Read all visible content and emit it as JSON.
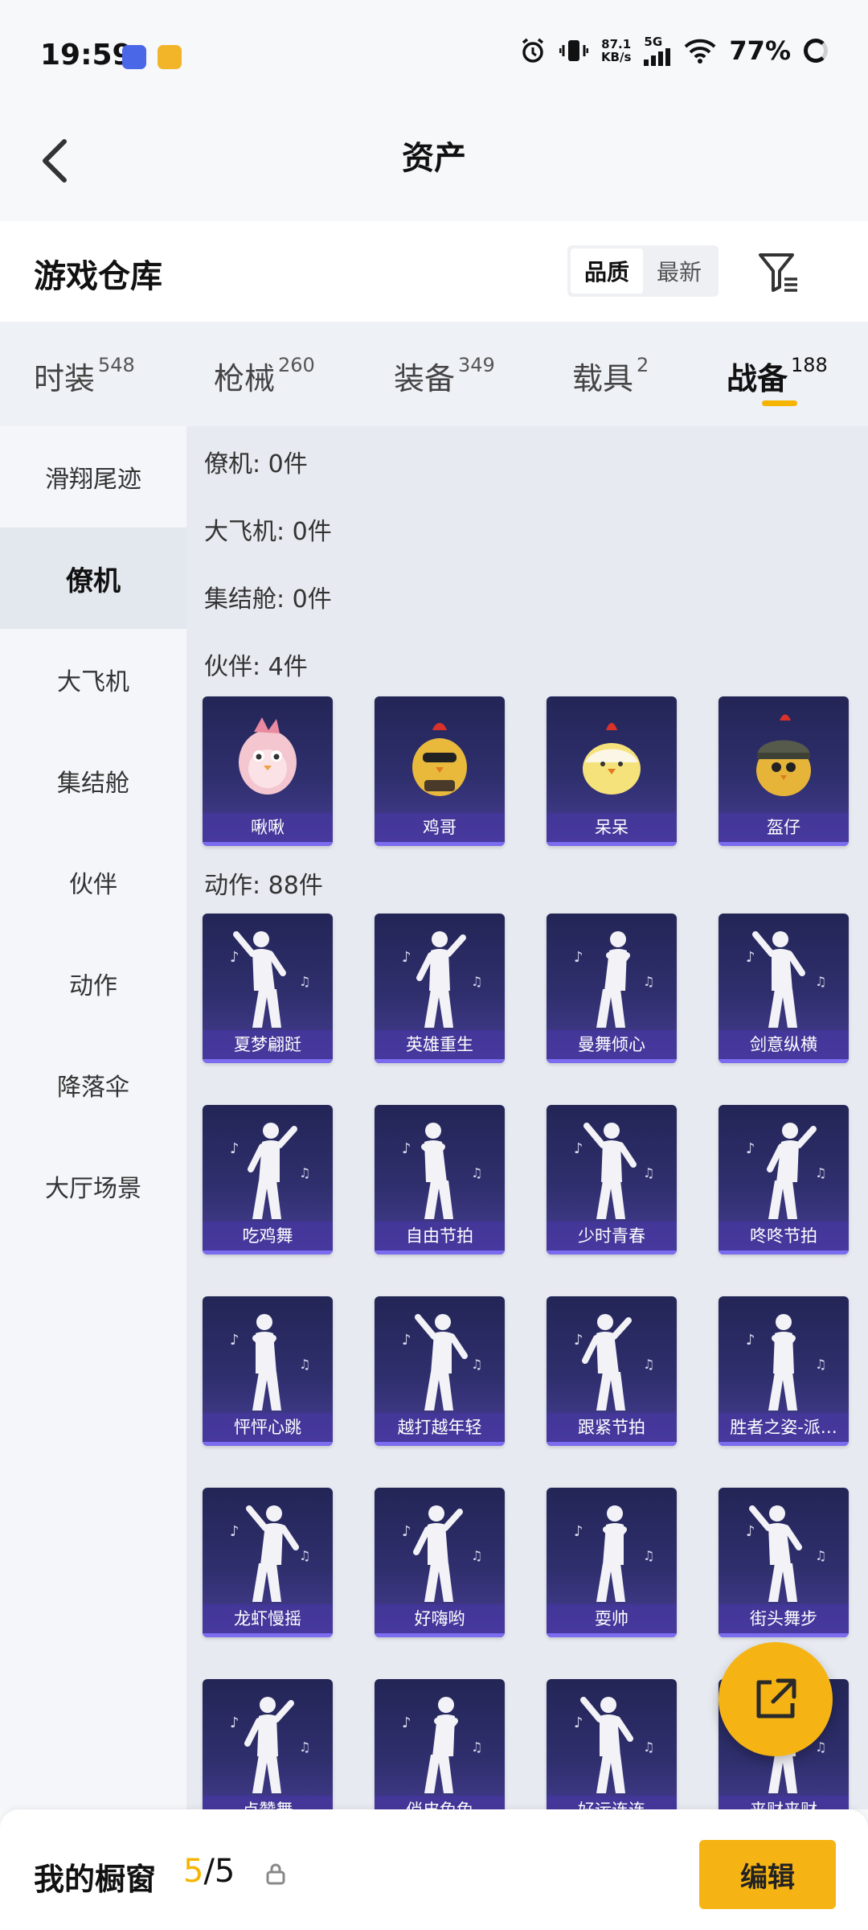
{
  "status_bar": {
    "time": "19:59",
    "net_speed_value": "87.1",
    "net_speed_unit": "KB/s",
    "network_type": "5G",
    "battery": "77%"
  },
  "header": {
    "title": "资产"
  },
  "warehouse": {
    "title": "游戏仓库",
    "sort_options": [
      "品质",
      "最新"
    ],
    "active_sort": "品质"
  },
  "category_tabs": [
    {
      "label": "时装",
      "count": "548"
    },
    {
      "label": "枪械",
      "count": "260"
    },
    {
      "label": "装备",
      "count": "349"
    },
    {
      "label": "载具",
      "count": "2"
    },
    {
      "label": "战备",
      "count": "188"
    }
  ],
  "active_tab": "战备",
  "sidebar": {
    "items": [
      "滑翔尾迹",
      "僚机",
      "大飞机",
      "集结舱",
      "伙伴",
      "动作",
      "降落伞",
      "大厅场景"
    ],
    "active": "僚机"
  },
  "sections": [
    {
      "label": "僚机: 0件"
    },
    {
      "label": "大飞机: 0件"
    },
    {
      "label": "集结舱: 0件"
    },
    {
      "label": "伙伴: 4件"
    },
    {
      "label": "动作: 88件"
    }
  ],
  "partner_items": [
    "啾啾",
    "鸡哥",
    "呆呆",
    "盔仔"
  ],
  "action_items": [
    "夏梦翩跹",
    "英雄重生",
    "曼舞倾心",
    "剑意纵横",
    "吃鸡舞",
    "自由节拍",
    "少时青春",
    "咚咚节拍",
    "怦怦心跳",
    "越打越年轻",
    "跟紧节拍",
    "胜者之姿-派…",
    "龙虾慢摇",
    "好嗨哟",
    "耍帅",
    "街头舞步",
    "点赞舞",
    "俏皮兔兔",
    "好运连连",
    "来财来财"
  ],
  "showcase": {
    "title": "我的橱窗",
    "current": "5",
    "total": "/5",
    "edit_label": "编辑"
  },
  "colors": {
    "accent": "#f6b414",
    "card_top": "#232556",
    "card_bottom": "#4a3f96"
  }
}
